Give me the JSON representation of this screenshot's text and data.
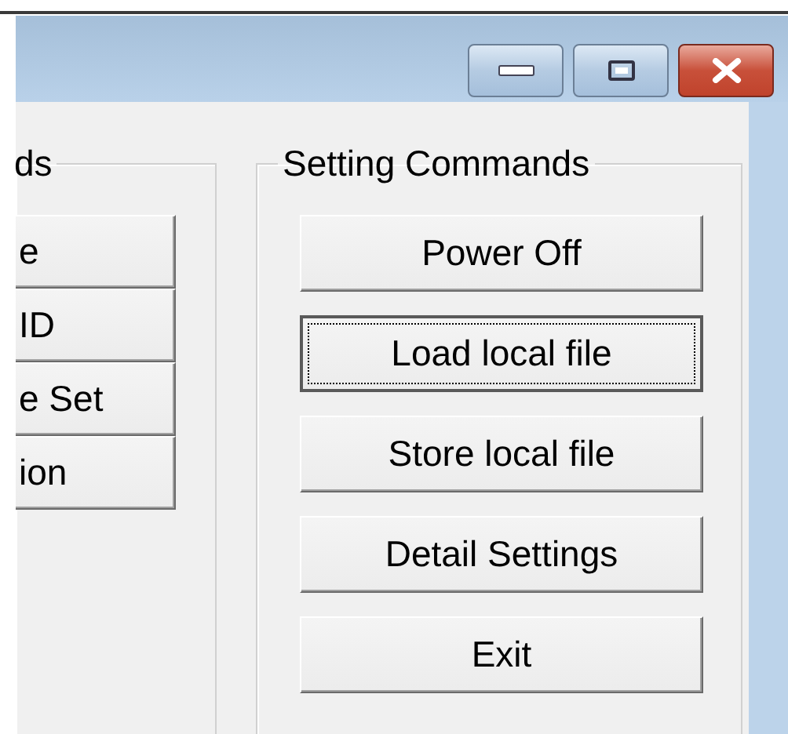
{
  "groups": [
    {
      "title": "ds",
      "buttons": [
        {
          "label": "e",
          "focused": false
        },
        {
          "label": "ID",
          "focused": false
        },
        {
          "label": "e Set",
          "focused": false
        },
        {
          "label": "ion",
          "focused": false
        }
      ]
    },
    {
      "title": "Setting Commands",
      "buttons": [
        {
          "label": "Power Off",
          "focused": false
        },
        {
          "label": "Load local file",
          "focused": true
        },
        {
          "label": "Store local file",
          "focused": false
        },
        {
          "label": "Detail Settings",
          "focused": false
        },
        {
          "label": "Exit",
          "focused": false
        }
      ]
    }
  ]
}
